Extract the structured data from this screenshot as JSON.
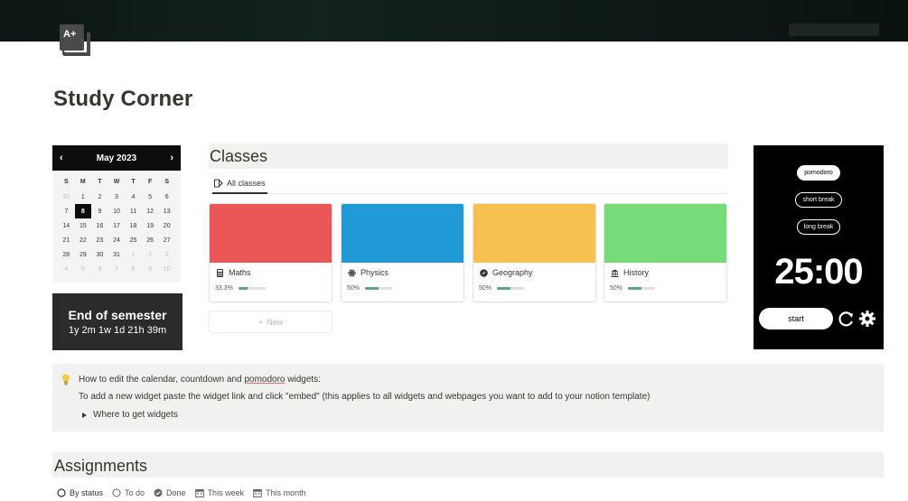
{
  "page": {
    "title": "Study Corner",
    "icon": "a-plus-book-icon"
  },
  "calendar": {
    "month_label": "May 2023",
    "prev": "‹",
    "next": "›",
    "weekdays": [
      "S",
      "M",
      "T",
      "W",
      "T",
      "F",
      "S"
    ],
    "days": [
      [
        "30",
        "1",
        "2",
        "3",
        "4",
        "5",
        "6"
      ],
      [
        "7",
        "8",
        "9",
        "10",
        "11",
        "12",
        "13"
      ],
      [
        "14",
        "15",
        "16",
        "17",
        "18",
        "19",
        "20"
      ],
      [
        "21",
        "22",
        "23",
        "24",
        "25",
        "26",
        "27"
      ],
      [
        "28",
        "29",
        "30",
        "31",
        "1",
        "2",
        "3"
      ],
      [
        "4",
        "5",
        "6",
        "7",
        "8",
        "9",
        "10"
      ]
    ],
    "selected": "8"
  },
  "countdown": {
    "title": "End of semester",
    "value": "1y 2m 1w 1d 21h 39m"
  },
  "classes": {
    "heading": "Classes",
    "tab_label": "All classes",
    "new_label": "New",
    "items": [
      {
        "name": "Maths",
        "progress_label": "33.3%",
        "progress": 0.333,
        "color": "#eb5757",
        "icon": "calculator-icon"
      },
      {
        "name": "Physics",
        "progress_label": "50%",
        "progress": 0.5,
        "color": "#1f9ad6",
        "icon": "atom-icon"
      },
      {
        "name": "Geography",
        "progress_label": "50%",
        "progress": 0.5,
        "color": "#f8c04f",
        "icon": "compass-icon"
      },
      {
        "name": "History",
        "progress_label": "50%",
        "progress": 0.5,
        "color": "#76db78",
        "icon": "museum-icon"
      }
    ]
  },
  "pomodoro": {
    "modes": [
      "pomodoro",
      "short break",
      "long break"
    ],
    "time": "25:00",
    "start_label": "start"
  },
  "callout": {
    "line1_pre": "How to edit the calendar, countdown and ",
    "line1_link": "pomodoro",
    "line1_post": " widgets:",
    "line2": "To add a new widget paste the widget link and click \"embed\" (this applies to all widgets and webpages you want to add to your notion template)",
    "toggle": "Where to get widgets"
  },
  "assignments": {
    "heading": "Assignments",
    "views": [
      "By status",
      "To do",
      "Done",
      "This week",
      "This month"
    ]
  }
}
